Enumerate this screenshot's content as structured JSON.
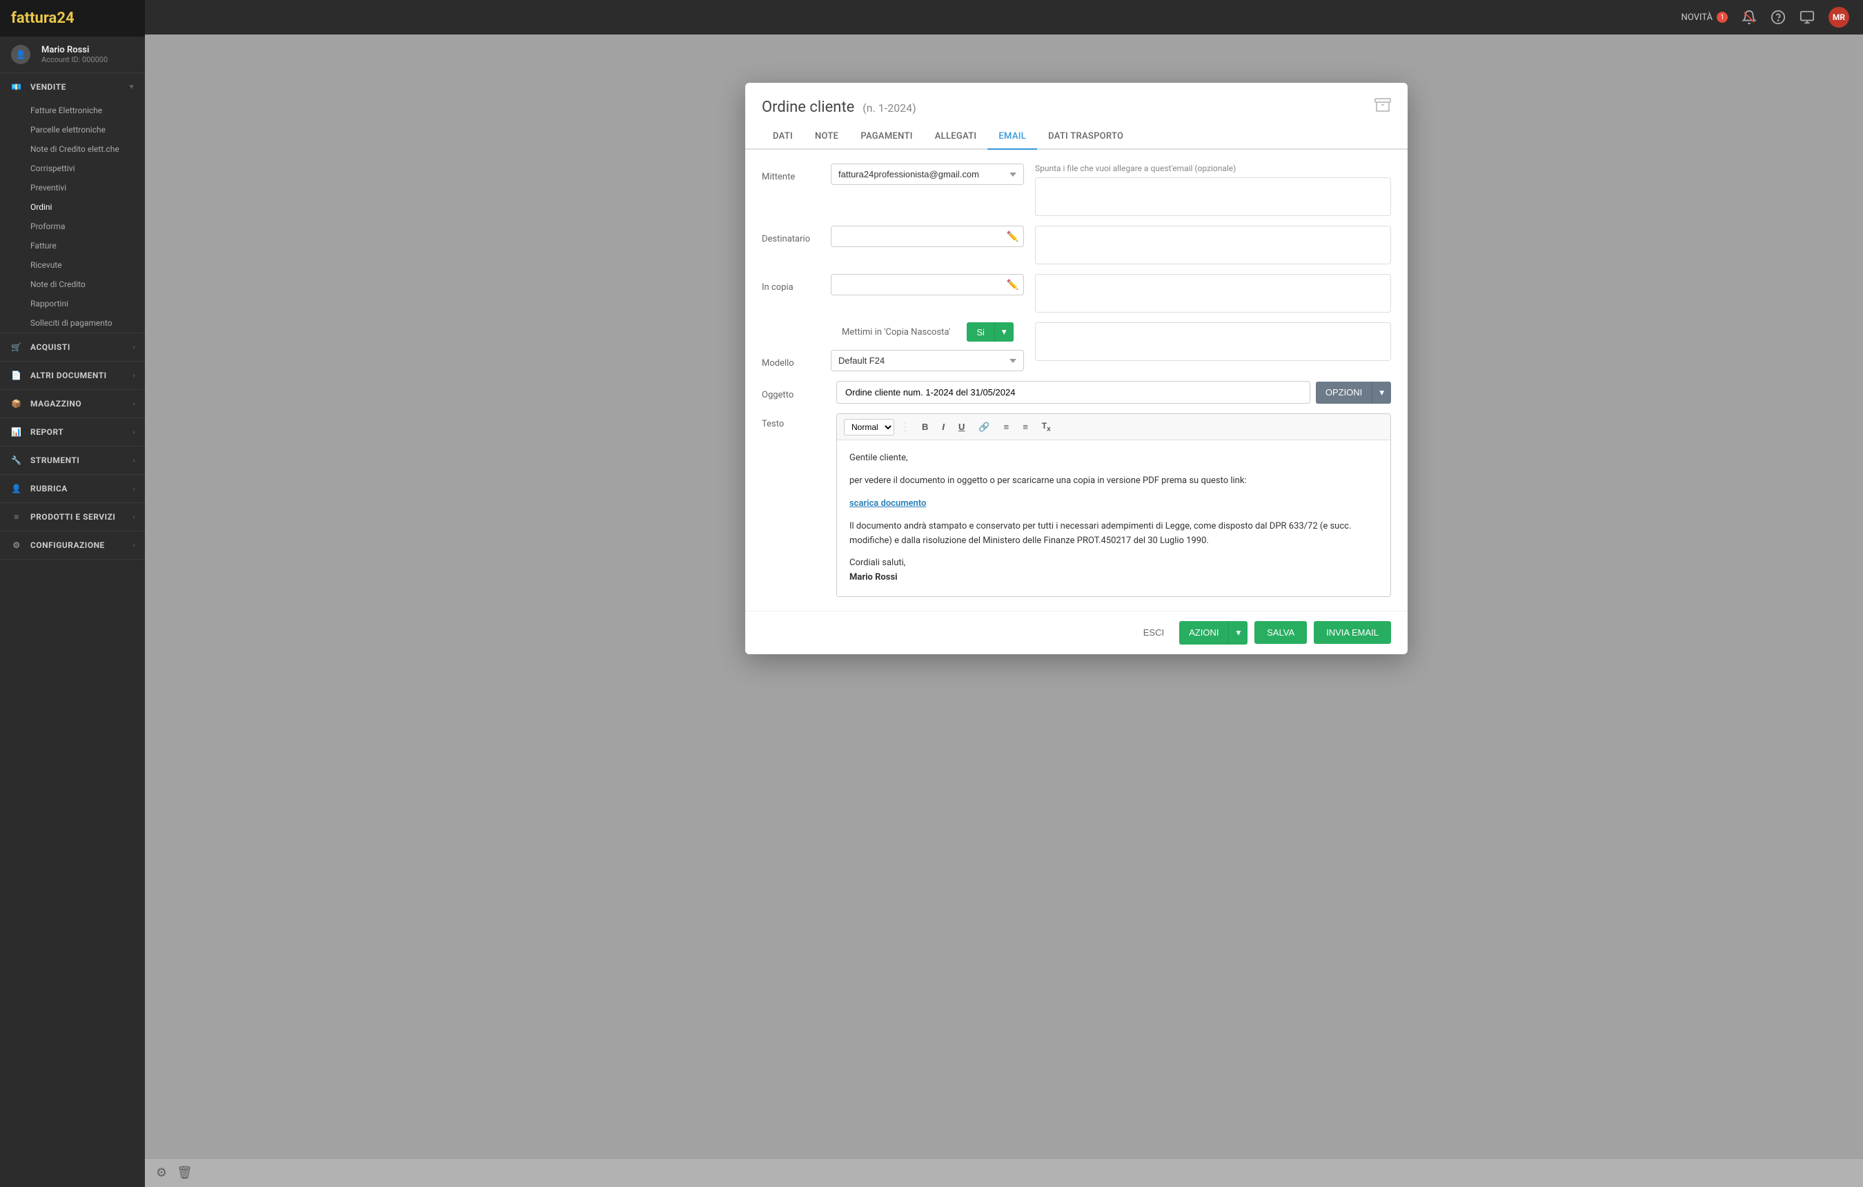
{
  "app": {
    "logo_main": "fattura",
    "logo_accent": "24",
    "topbar": {
      "novita_label": "NOVITÀ",
      "novita_count": "1",
      "avatar_initials": "MR"
    }
  },
  "sidebar": {
    "user": {
      "name": "Mario Rossi",
      "account_id": "Account ID: 000000"
    },
    "sections": [
      {
        "id": "vendite",
        "label": "VENDITE",
        "icon": "euro",
        "expanded": true,
        "items": [
          {
            "label": "Fatture Elettroniche",
            "active": false
          },
          {
            "label": "Parcelle elettroniche",
            "active": false
          },
          {
            "label": "Note di Credito elett.che",
            "active": false
          },
          {
            "label": "Corrispettivi",
            "active": false
          },
          {
            "label": "Preventivi",
            "active": false
          },
          {
            "label": "Ordini",
            "active": true
          },
          {
            "label": "Proforma",
            "active": false
          },
          {
            "label": "Fatture",
            "active": false
          },
          {
            "label": "Ricevute",
            "active": false
          },
          {
            "label": "Note di Credito",
            "active": false
          },
          {
            "label": "Rapportini",
            "active": false
          },
          {
            "label": "Solleciti di pagamento",
            "active": false
          }
        ]
      },
      {
        "id": "acquisti",
        "label": "ACQUISTI",
        "icon": "cart",
        "expanded": false,
        "items": []
      },
      {
        "id": "altri",
        "label": "ALTRI DOCUMENTI",
        "icon": "doc",
        "expanded": false,
        "items": []
      },
      {
        "id": "magazzino",
        "label": "MAGAZZINO",
        "icon": "box",
        "expanded": false,
        "items": []
      },
      {
        "id": "report",
        "label": "REPORT",
        "icon": "chart",
        "expanded": false,
        "items": []
      },
      {
        "id": "strumenti",
        "label": "STRUMENTI",
        "icon": "tools",
        "expanded": false,
        "items": []
      },
      {
        "id": "rubrica",
        "label": "RUBRICA",
        "icon": "person",
        "expanded": false,
        "items": []
      },
      {
        "id": "prodotti",
        "label": "PRODOTTI E SERVIZI",
        "icon": "list",
        "expanded": false,
        "items": []
      },
      {
        "id": "configurazione",
        "label": "CONFIGURAZIONE",
        "icon": "gear",
        "expanded": false,
        "items": []
      }
    ]
  },
  "modal": {
    "title": "Ordine cliente",
    "number": "(n. 1-2024)",
    "tabs": [
      {
        "id": "dati",
        "label": "DATI"
      },
      {
        "id": "note",
        "label": "NOTE"
      },
      {
        "id": "pagamenti",
        "label": "PAGAMENTI"
      },
      {
        "id": "allegati",
        "label": "ALLEGATI"
      },
      {
        "id": "email",
        "label": "EMAIL",
        "active": true
      },
      {
        "id": "dati_trasporto",
        "label": "DATI TRASPORTO"
      }
    ],
    "form": {
      "mittente_label": "Mittente",
      "mittente_value": "fattura24professionista@gmail.com",
      "destinatario_label": "Destinatario",
      "in_copia_label": "In copia",
      "bcc_label": "Mettimi in 'Copia Nascosta'",
      "bcc_value": "Si",
      "modello_label": "Modello",
      "modello_value": "Default F24",
      "attachment_hint": "Spunta i file che vuoi allegare a quest'email (opzionale)",
      "oggetto_label": "Oggetto",
      "oggetto_value": "Ordine cliente num. 1-2024 del 31/05/2024",
      "opzioni_label": "OPZIONI",
      "testo_label": "Testo"
    },
    "editor": {
      "toolbar_style": "Normal",
      "body_lines": [
        "Gentile cliente,",
        "per vedere il documento in oggetto o per scaricarne una copia in versione PDF prema su questo link:",
        "",
        "Il documento andrà stampato e conservato per tutti i necessari adempimenti di Legge, come disposto dal DPR 633/72 (e succ. modifiche) e dalla risoluzione del Ministero delle Finanze PROT.450217 del 30 Luglio 1990.",
        "",
        "Cordiali saluti,"
      ],
      "link_text": "scarica documento",
      "signature_name": "Mario Rossi"
    },
    "footer": {
      "esci_label": "ESCI",
      "azioni_label": "AZIONI",
      "salva_label": "SALVA",
      "invia_label": "INVIA EMAIL"
    }
  },
  "bottom_bar": {
    "gear_icon": "⚙",
    "trash_icon": "🗑"
  }
}
